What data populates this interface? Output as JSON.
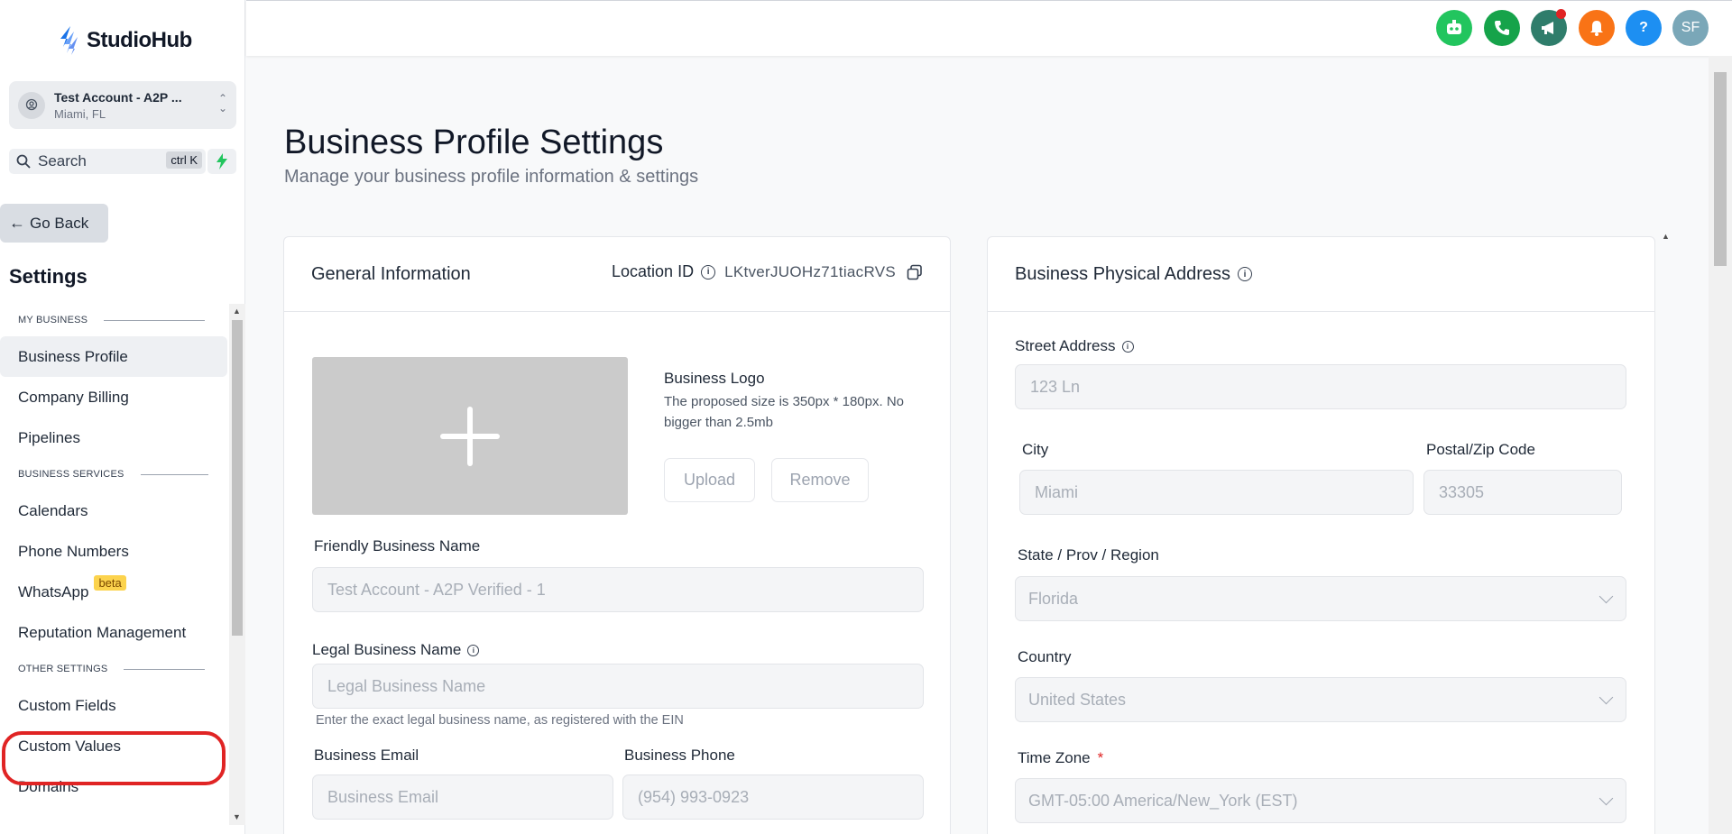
{
  "brand": {
    "name": "StudioHub"
  },
  "account": {
    "name": "Test Account - A2P ...",
    "location": "Miami, FL"
  },
  "search": {
    "label": "Search",
    "shortcut": "ctrl K"
  },
  "nav_back": {
    "label": "Go Back"
  },
  "sidebar": {
    "title": "Settings",
    "sections": {
      "my_business": "MY BUSINESS",
      "business_services": "BUSINESS SERVICES",
      "other_settings": "OTHER SETTINGS"
    },
    "items": {
      "business_profile": "Business Profile",
      "company_billing": "Company Billing",
      "pipelines": "Pipelines",
      "calendars": "Calendars",
      "phone_numbers": "Phone Numbers",
      "whatsapp": "WhatsApp",
      "whatsapp_badge": "beta",
      "reputation": "Reputation Management",
      "custom_fields": "Custom Fields",
      "custom_values": "Custom Values",
      "domains": "Domains"
    }
  },
  "topbar": {
    "avatar_initials": "SF",
    "help_symbol": "?",
    "colors": {
      "bot": "#22c55e",
      "phone": "#16a34a",
      "megaphone": "#2f7d6b",
      "bell": "#f97316",
      "help": "#1d8ff2",
      "avatar": "#7aa7b8"
    }
  },
  "page": {
    "title": "Business Profile Settings",
    "subtitle": "Manage your business profile information & settings"
  },
  "general": {
    "title": "General Information",
    "location_label": "Location ID",
    "location_id": "LKtverJUOHz71tiacRVS",
    "logo_title": "Business Logo",
    "logo_desc": "The proposed size is 350px * 180px. No bigger than 2.5mb",
    "upload_label": "Upload",
    "remove_label": "Remove",
    "friendly_label": "Friendly Business Name",
    "friendly_value": "Test Account - A2P Verified - 1",
    "legal_label": "Legal Business Name",
    "legal_placeholder": "Legal Business Name",
    "legal_help": "Enter the exact legal business name, as registered with the EIN",
    "email_label": "Business Email",
    "email_placeholder": "Business Email",
    "phone_label": "Business Phone",
    "phone_placeholder": "(954) 993-0923"
  },
  "address": {
    "title": "Business Physical Address",
    "street_label": "Street Address",
    "street_value": "123 Ln",
    "city_label": "City",
    "city_value": "Miami",
    "zip_label": "Postal/Zip Code",
    "zip_value": "33305",
    "state_label": "State / Prov / Region",
    "state_value": "Florida",
    "country_label": "Country",
    "country_value": "United States",
    "tz_label": "Time Zone",
    "tz_required": "*",
    "tz_value": "GMT-05:00 America/New_York (EST)"
  }
}
